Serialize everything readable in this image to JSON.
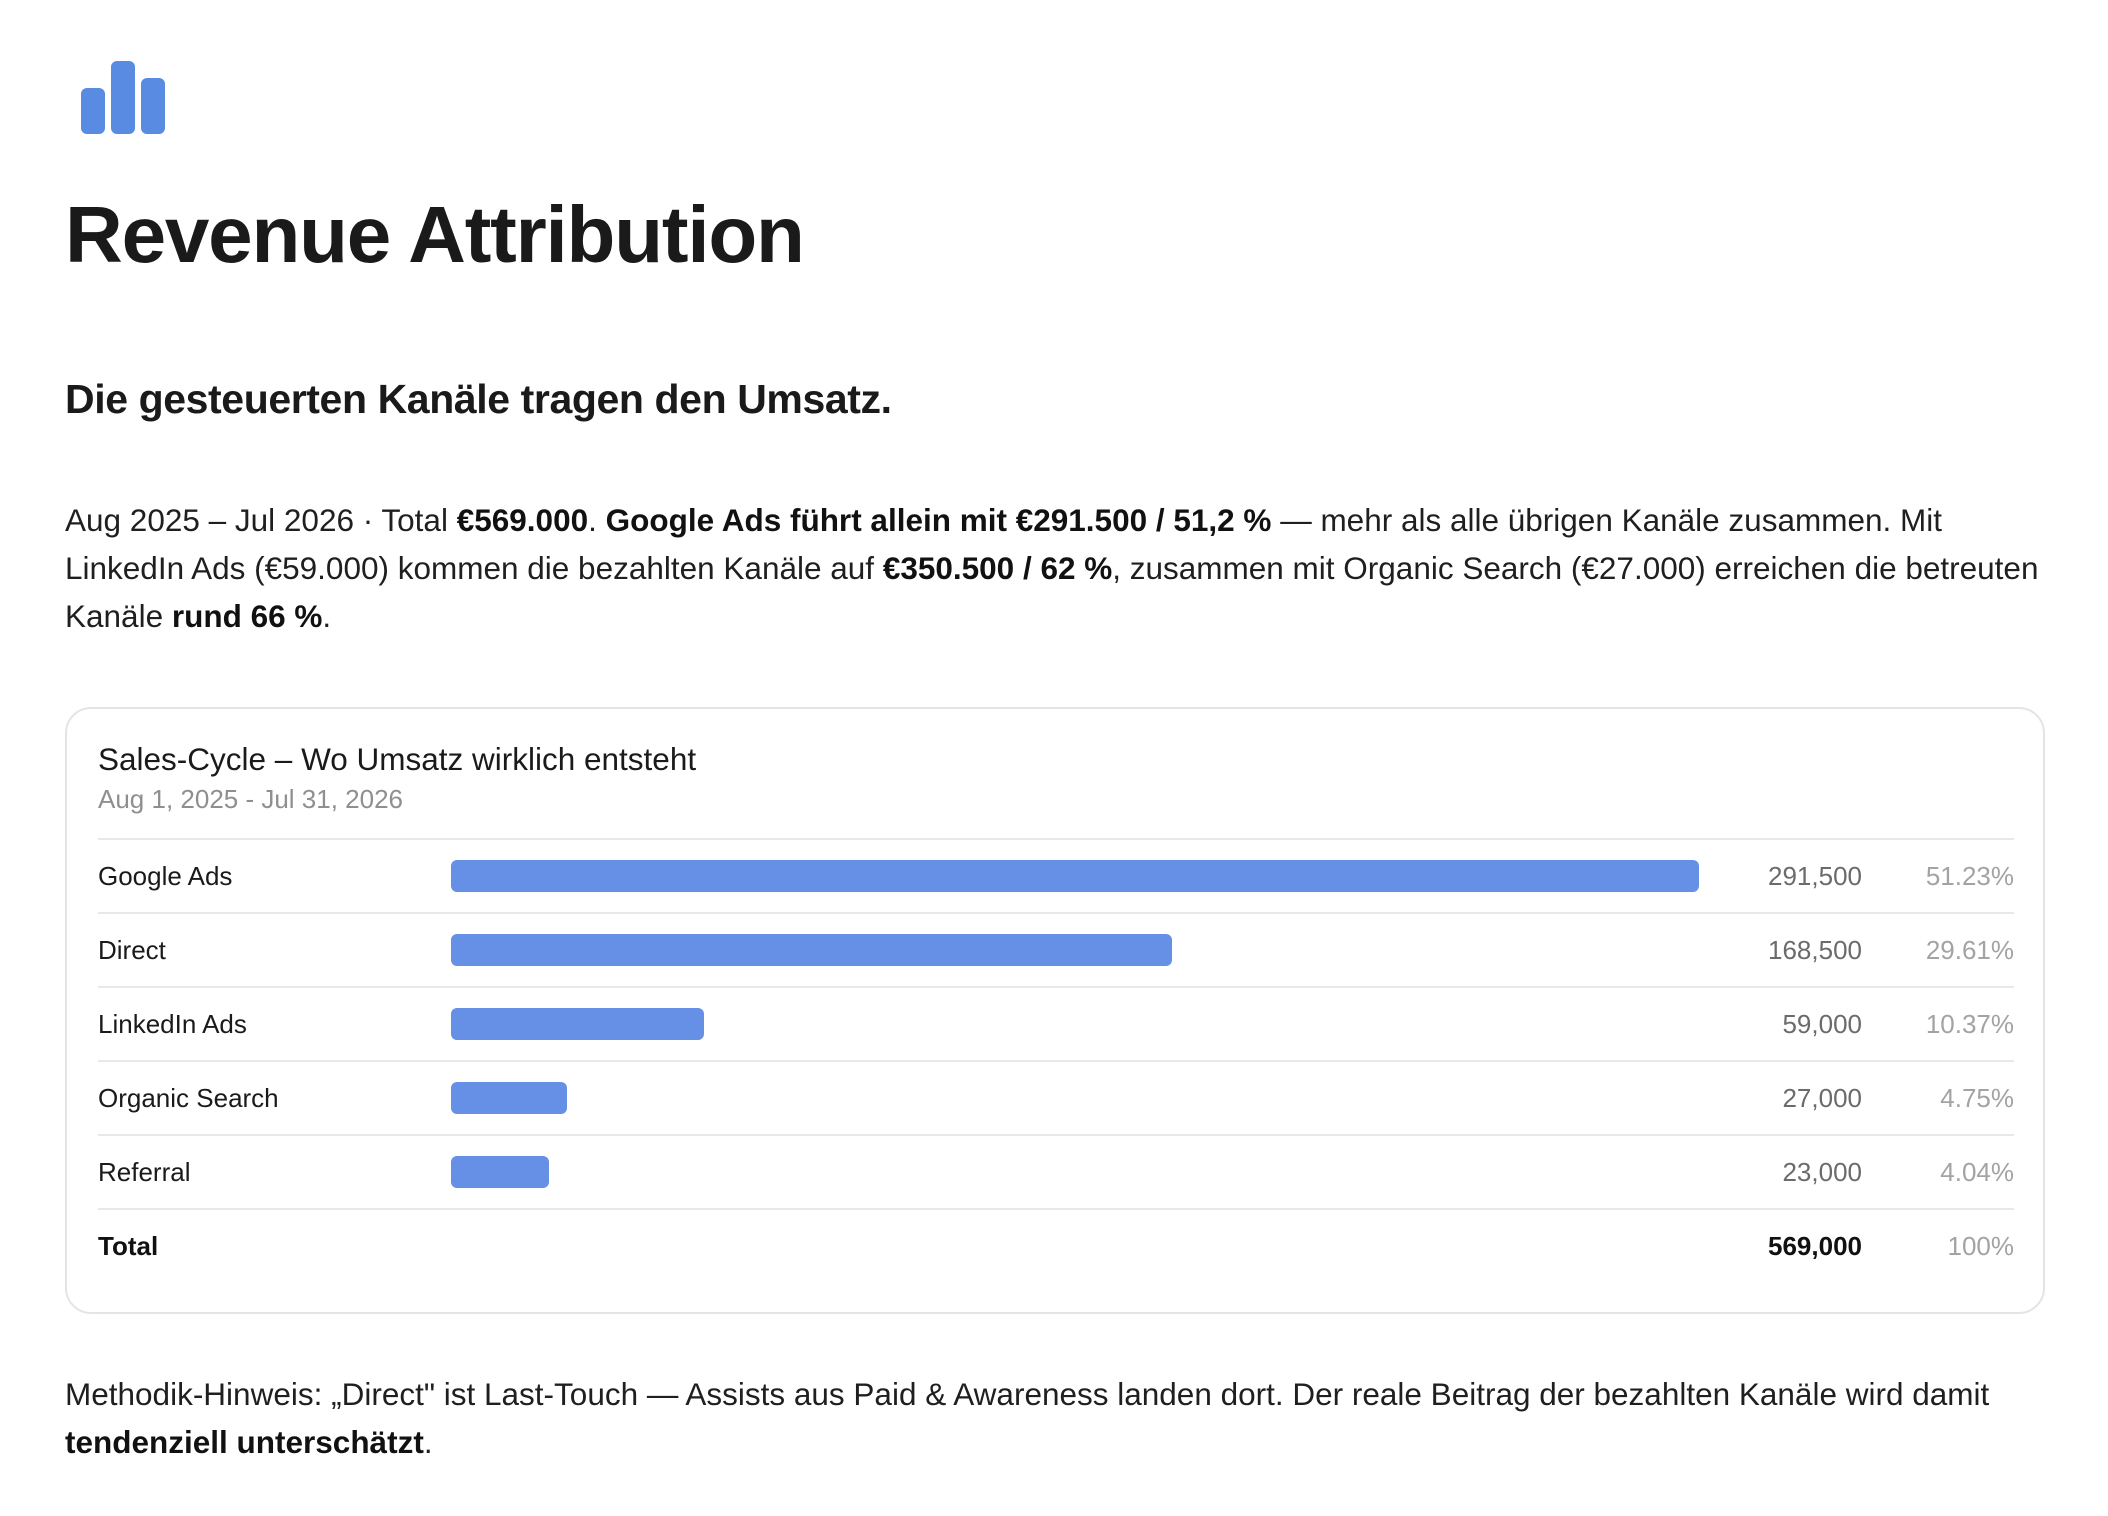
{
  "header": {
    "logo_icon": "bar-chart-icon",
    "title": "Revenue Attribution",
    "subheading": "Die gesteuerten Kanäle tragen den Umsatz."
  },
  "intro": {
    "p1": "Aug 2025 – Jul 2026 · Total ",
    "b1": "€569.000",
    "p2": ". ",
    "b2": "Google Ads führt allein mit €291.500 / 51,2 %",
    "p3": " — mehr als alle übrigen Kanäle zusammen. Mit LinkedIn Ads (€59.000) kommen die bezahlten Kanäle auf ",
    "b3": "€350.500 / 62 %",
    "p4": ", zusammen mit Organic Search (€27.000) erreichen die betreuten Kanäle ",
    "b4": "rund 66 %",
    "p5": "."
  },
  "colors": {
    "bar": "#6590e6",
    "text": "#1a1a1a",
    "muted": "#8f8f8f",
    "border": "#e4e4e4"
  },
  "chart_data": {
    "type": "bar",
    "orientation": "horizontal",
    "title": "Sales-Cycle – Wo Umsatz wirklich entsteht",
    "subtitle": "Aug 1, 2025 - Jul 31, 2026",
    "max_value": 291500,
    "rows": [
      {
        "label": "Google Ads",
        "value": 291500,
        "value_label": "291,500",
        "pct_label": "51.23%"
      },
      {
        "label": "Direct",
        "value": 168500,
        "value_label": "168,500",
        "pct_label": "29.61%"
      },
      {
        "label": "LinkedIn Ads",
        "value": 59000,
        "value_label": "59,000",
        "pct_label": "10.37%"
      },
      {
        "label": "Organic Search",
        "value": 27000,
        "value_label": "27,000",
        "pct_label": "4.75%"
      },
      {
        "label": "Referral",
        "value": 23000,
        "value_label": "23,000",
        "pct_label": "4.04%"
      }
    ],
    "total": {
      "label": "Total",
      "value_label": "569,000",
      "pct_label": "100%"
    }
  },
  "note": {
    "p1": "Methodik-Hinweis: „Direct\" ist Last-Touch — Assists aus Paid & Awareness landen dort. Der reale Beitrag der bezahlten Kanäle wird damit ",
    "b1": "tendenziell unterschätzt",
    "p2": "."
  }
}
